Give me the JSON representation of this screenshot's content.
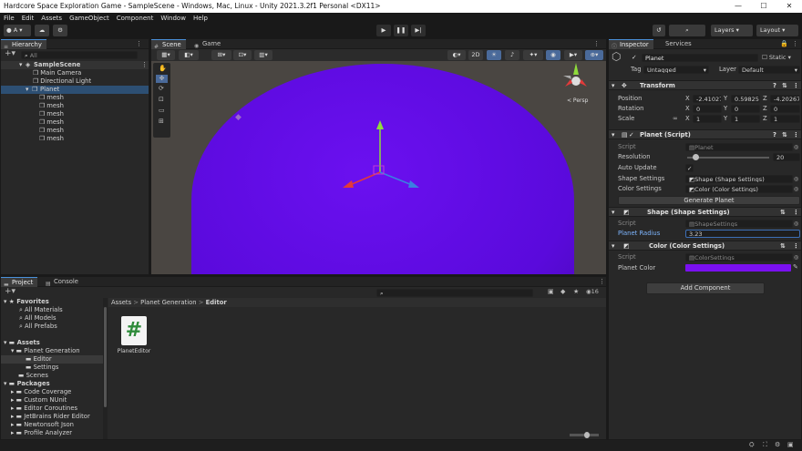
{
  "window": {
    "title": "Hardcore Space Exploration Game - SampleScene - Windows, Mac, Linux - Unity 2021.3.2f1 Personal <DX11>",
    "minimize": "—",
    "maximize": "☐",
    "close": "✕"
  },
  "menu": [
    "File",
    "Edit",
    "Assets",
    "GameObject",
    "Component",
    "Window",
    "Help"
  ],
  "toolbar": {
    "account": "A",
    "layers": "Layers",
    "layout": "Layout"
  },
  "hierarchy": {
    "tab": "Hierarchy",
    "search_placeholder": "All",
    "scene": "SampleScene",
    "items": [
      "Main Camera",
      "Directional Light",
      "Planet"
    ],
    "children": [
      "mesh",
      "mesh",
      "mesh",
      "mesh",
      "mesh",
      "mesh"
    ]
  },
  "scene_view": {
    "tab_scene": "Scene",
    "tab_game": "Game",
    "mode_2d": "2D",
    "persp": "< Persp",
    "colors": {
      "sphere": "#6b10f0",
      "background": "#4a4642"
    }
  },
  "project": {
    "tab_project": "Project",
    "tab_console": "Console",
    "favorites_label": "Favorites",
    "favorites": [
      "All Materials",
      "All Models",
      "All Prefabs"
    ],
    "assets_label": "Assets",
    "assets_tree": [
      "Planet Generation",
      "Editor",
      "Settings",
      "Scenes"
    ],
    "packages_label": "Packages",
    "packages": [
      "Code Coverage",
      "Custom NUnit",
      "Editor Coroutines",
      "JetBrains Rider Editor",
      "Newtonsoft Json",
      "Profile Analyzer"
    ],
    "breadcrumb": [
      "Assets",
      "Planet Generation",
      "Editor"
    ],
    "file_name": "PlanetEditor",
    "count": "16"
  },
  "inspector": {
    "tab_inspector": "Inspector",
    "tab_services": "Services",
    "object_name": "Planet",
    "static_label": "Static",
    "tag_label": "Tag",
    "tag_value": "Untagged",
    "layer_label": "Layer",
    "layer_value": "Default",
    "transform": {
      "title": "Transform",
      "position_label": "Position",
      "rotation_label": "Rotation",
      "scale_label": "Scale",
      "position": [
        "-2.41027",
        "0.598257",
        "-4.20267"
      ],
      "rotation": [
        "0",
        "0",
        "0"
      ],
      "scale": [
        "1",
        "1",
        "1"
      ],
      "axes": [
        "X",
        "Y",
        "Z"
      ]
    },
    "planet_script": {
      "title": "Planet (Script)",
      "script_label": "Script",
      "script_value": "Planet",
      "resolution_label": "Resolution",
      "resolution_value": "20",
      "resolution_fraction": 0.1,
      "auto_update_label": "Auto Update",
      "auto_update_check": "✓",
      "shape_label": "Shape Settings",
      "shape_value": "Shape (Shape Settings)",
      "color_label": "Color Settings",
      "color_value": "Color (Color Settings)",
      "generate_button": "Generate Planet"
    },
    "shape_settings": {
      "title": "Shape (Shape Settings)",
      "script_label": "Script",
      "script_value": "ShapeSettings",
      "radius_label": "Planet Radius",
      "radius_value": "3.23"
    },
    "color_settings": {
      "title": "Color (Color Settings)",
      "script_label": "Script",
      "script_value": "ColorSettings",
      "color_label": "Planet Color",
      "color_hex": "#7a10f0"
    },
    "add_component": "Add Component"
  }
}
